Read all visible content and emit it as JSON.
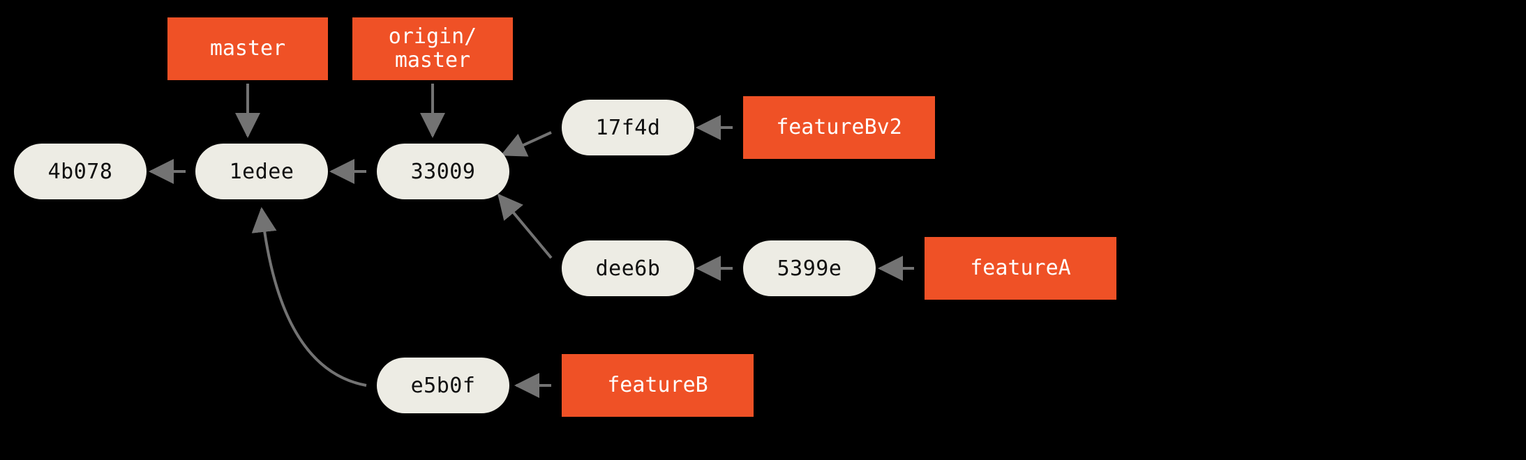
{
  "diagram": {
    "type": "git-graph",
    "colors": {
      "background": "#000000",
      "commit_fill": "#edece4",
      "commit_text": "#101010",
      "branch_fill": "#ef5126",
      "branch_text": "#ffffff",
      "edge": "#737373"
    },
    "commits": {
      "c_4b078": {
        "hash": "4b078"
      },
      "c_1edee": {
        "hash": "1edee"
      },
      "c_33009": {
        "hash": "33009"
      },
      "c_17f4d": {
        "hash": "17f4d"
      },
      "c_dee6b": {
        "hash": "dee6b"
      },
      "c_5399e": {
        "hash": "5399e"
      },
      "c_e5b0f": {
        "hash": "e5b0f"
      }
    },
    "branches": {
      "b_master": {
        "name": "master"
      },
      "b_origin_master": {
        "name": "origin/\nmaster"
      },
      "b_featureBv2": {
        "name": "featureBv2"
      },
      "b_featureA": {
        "name": "featureA"
      },
      "b_featureB": {
        "name": "featureB"
      }
    },
    "edges": [
      {
        "from": "c_1edee",
        "to": "c_4b078",
        "kind": "parent"
      },
      {
        "from": "c_33009",
        "to": "c_1edee",
        "kind": "parent"
      },
      {
        "from": "c_17f4d",
        "to": "c_33009",
        "kind": "parent"
      },
      {
        "from": "c_dee6b",
        "to": "c_33009",
        "kind": "parent"
      },
      {
        "from": "c_5399e",
        "to": "c_dee6b",
        "kind": "parent"
      },
      {
        "from": "c_e5b0f",
        "to": "c_1edee",
        "kind": "parent"
      },
      {
        "from": "b_master",
        "to": "c_1edee",
        "kind": "ref"
      },
      {
        "from": "b_origin_master",
        "to": "c_33009",
        "kind": "ref"
      },
      {
        "from": "b_featureBv2",
        "to": "c_17f4d",
        "kind": "ref"
      },
      {
        "from": "b_featureA",
        "to": "c_5399e",
        "kind": "ref"
      },
      {
        "from": "b_featureB",
        "to": "c_e5b0f",
        "kind": "ref"
      }
    ]
  }
}
